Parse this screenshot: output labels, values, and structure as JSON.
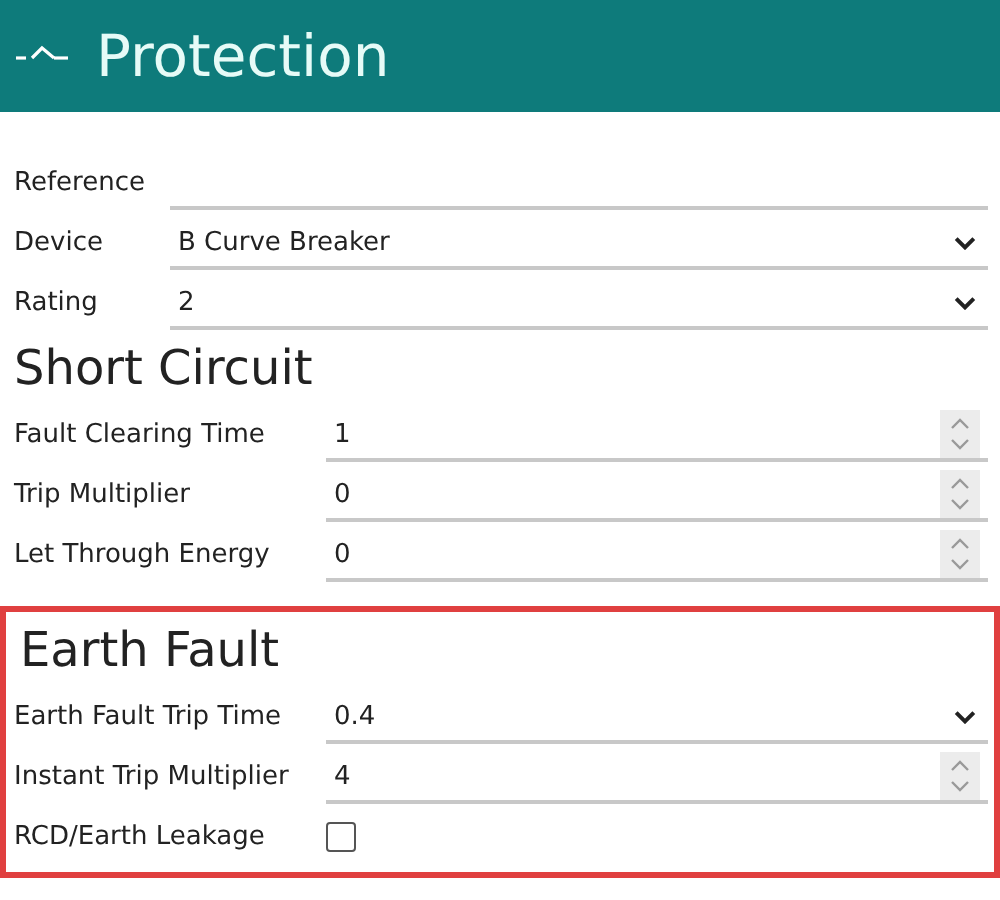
{
  "header": {
    "title": "Protection"
  },
  "general": [
    {
      "label": "Reference",
      "kind": "text"
    },
    {
      "label": "Device",
      "kind": "select",
      "value": "B Curve Breaker"
    },
    {
      "label": "Rating",
      "kind": "select",
      "value": "2"
    }
  ],
  "sections": [
    {
      "title": "Short Circuit",
      "highlighted": false,
      "fields": [
        {
          "label": "Fault Clearing Time",
          "kind": "spin",
          "value": "1"
        },
        {
          "label": "Trip Multiplier",
          "kind": "spin",
          "value": "0"
        },
        {
          "label": "Let Through Energy",
          "kind": "spin",
          "value": "0"
        }
      ]
    },
    {
      "title": "Earth Fault",
      "highlighted": true,
      "fields": [
        {
          "label": "Earth Fault Trip Time",
          "kind": "select",
          "value": "0.4"
        },
        {
          "label": "Instant Trip Multiplier",
          "kind": "spin",
          "value": "4"
        },
        {
          "label": "RCD/Earth Leakage",
          "kind": "checkbox",
          "checked": false
        }
      ]
    }
  ]
}
